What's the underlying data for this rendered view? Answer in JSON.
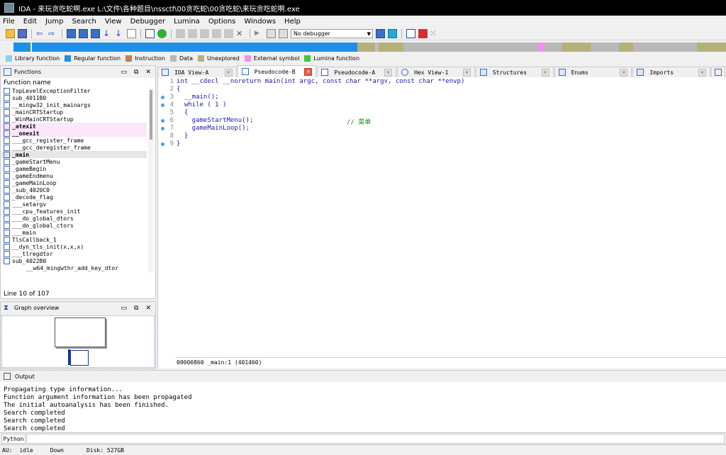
{
  "window": {
    "title": "IDA - 来玩贪吃蛇啊.exe L:\\文件\\各种题目\\nssctf\\00贪吃蛇\\00贪吃蛇\\来玩贪吃蛇啊.exe"
  },
  "menu": [
    "File",
    "Edit",
    "Jump",
    "Search",
    "View",
    "Debugger",
    "Lumina",
    "Options",
    "Windows",
    "Help"
  ],
  "toolbar": {
    "debugger_select": "No debugger"
  },
  "legend": [
    {
      "label": "Library function",
      "color": "#7fd4ee"
    },
    {
      "label": "Regular function",
      "color": "#1e90e8"
    },
    {
      "label": "Instruction",
      "color": "#c87c5a"
    },
    {
      "label": "Data",
      "color": "#b8b8b8"
    },
    {
      "label": "Unexplored",
      "color": "#b5b07a"
    },
    {
      "label": "External symbol",
      "color": "#f58ef0"
    },
    {
      "label": "Lumina function",
      "color": "#38c838"
    }
  ],
  "functions_pane": {
    "title": "Functions",
    "column_header": "Function name",
    "status": "Line 10 of 107",
    "items": [
      {
        "name": "TopLevelExceptionFilter",
        "style": ""
      },
      {
        "name": "sub_4011B0",
        "style": ""
      },
      {
        "name": "__mingw32_init_mainargs",
        "style": ""
      },
      {
        "name": "_mainCRTStartup",
        "style": ""
      },
      {
        "name": "_WinMainCRTStartup",
        "style": ""
      },
      {
        "name": "_atexit",
        "style": "lib"
      },
      {
        "name": "__onexit",
        "style": "lib"
      },
      {
        "name": "___gcc_register_frame",
        "style": ""
      },
      {
        "name": "___gcc_deregister_frame",
        "style": ""
      },
      {
        "name": "_main",
        "style": "sel"
      },
      {
        "name": "_gameStartMenu",
        "style": ""
      },
      {
        "name": "_gameBegin",
        "style": ""
      },
      {
        "name": "_gameEndmenu",
        "style": ""
      },
      {
        "name": "_gameMainLoop",
        "style": ""
      },
      {
        "name": "_sub_4020C0",
        "style": ""
      },
      {
        "name": "_decode_flag",
        "style": ""
      },
      {
        "name": "___setargv",
        "style": ""
      },
      {
        "name": "___cpu_features_init",
        "style": ""
      },
      {
        "name": "___do_global_dtors",
        "style": ""
      },
      {
        "name": "___do_global_ctors",
        "style": ""
      },
      {
        "name": "___main",
        "style": ""
      },
      {
        "name": "TlsCallback_1",
        "style": ""
      },
      {
        "name": "__dyn_tls_init(x,x,x)",
        "style": ""
      },
      {
        "name": "___tlregdtor",
        "style": ""
      },
      {
        "name": "sub_4022B0",
        "style": ""
      },
      {
        "name": "__w64_mingwthr_add_key_dtor",
        "style": ""
      }
    ]
  },
  "graph_pane": {
    "title": "Graph overview"
  },
  "tabs": [
    {
      "label": "IDA View-A",
      "active": false
    },
    {
      "label": "Pseudocode-B",
      "active": true
    },
    {
      "label": "Pseudocode-A",
      "active": false
    },
    {
      "label": "Hex View-1",
      "active": false
    },
    {
      "label": "Structures",
      "active": false
    },
    {
      "label": "Enums",
      "active": false
    },
    {
      "label": "Imports",
      "active": false
    }
  ],
  "code": {
    "lines": [
      {
        "num": "1",
        "bp": false,
        "text": "int __cdecl __noreturn main(int argc, const char **argv, const char **envp)",
        "comment": ""
      },
      {
        "num": "2",
        "bp": false,
        "text": "{",
        "comment": ""
      },
      {
        "num": "3",
        "bp": true,
        "text": "  __main();",
        "comment": ""
      },
      {
        "num": "4",
        "bp": true,
        "text": "  while ( 1 )",
        "comment": ""
      },
      {
        "num": "5",
        "bp": false,
        "text": "  {",
        "comment": ""
      },
      {
        "num": "6",
        "bp": true,
        "text": "    gameStartMenu();",
        "comment": "// 菜单"
      },
      {
        "num": "7",
        "bp": true,
        "text": "    gameMainLoop();",
        "comment": ""
      },
      {
        "num": "8",
        "bp": false,
        "text": "  }",
        "comment": ""
      },
      {
        "num": "9",
        "bp": true,
        "text": "}",
        "comment": ""
      }
    ],
    "status": "00000860 _main:1 (401460)"
  },
  "output": {
    "title": "Output",
    "lines": [
      "Propagating type information...",
      "Function argument information has been propagated",
      "The initial autoanalysis has been finished.",
      "Search completed",
      "Search completed",
      "Search completed"
    ],
    "python_tab": "Python"
  },
  "statusbar": {
    "au": "AU:",
    "state": "idle",
    "dir": "Down",
    "disk": "Disk: 527GB"
  }
}
